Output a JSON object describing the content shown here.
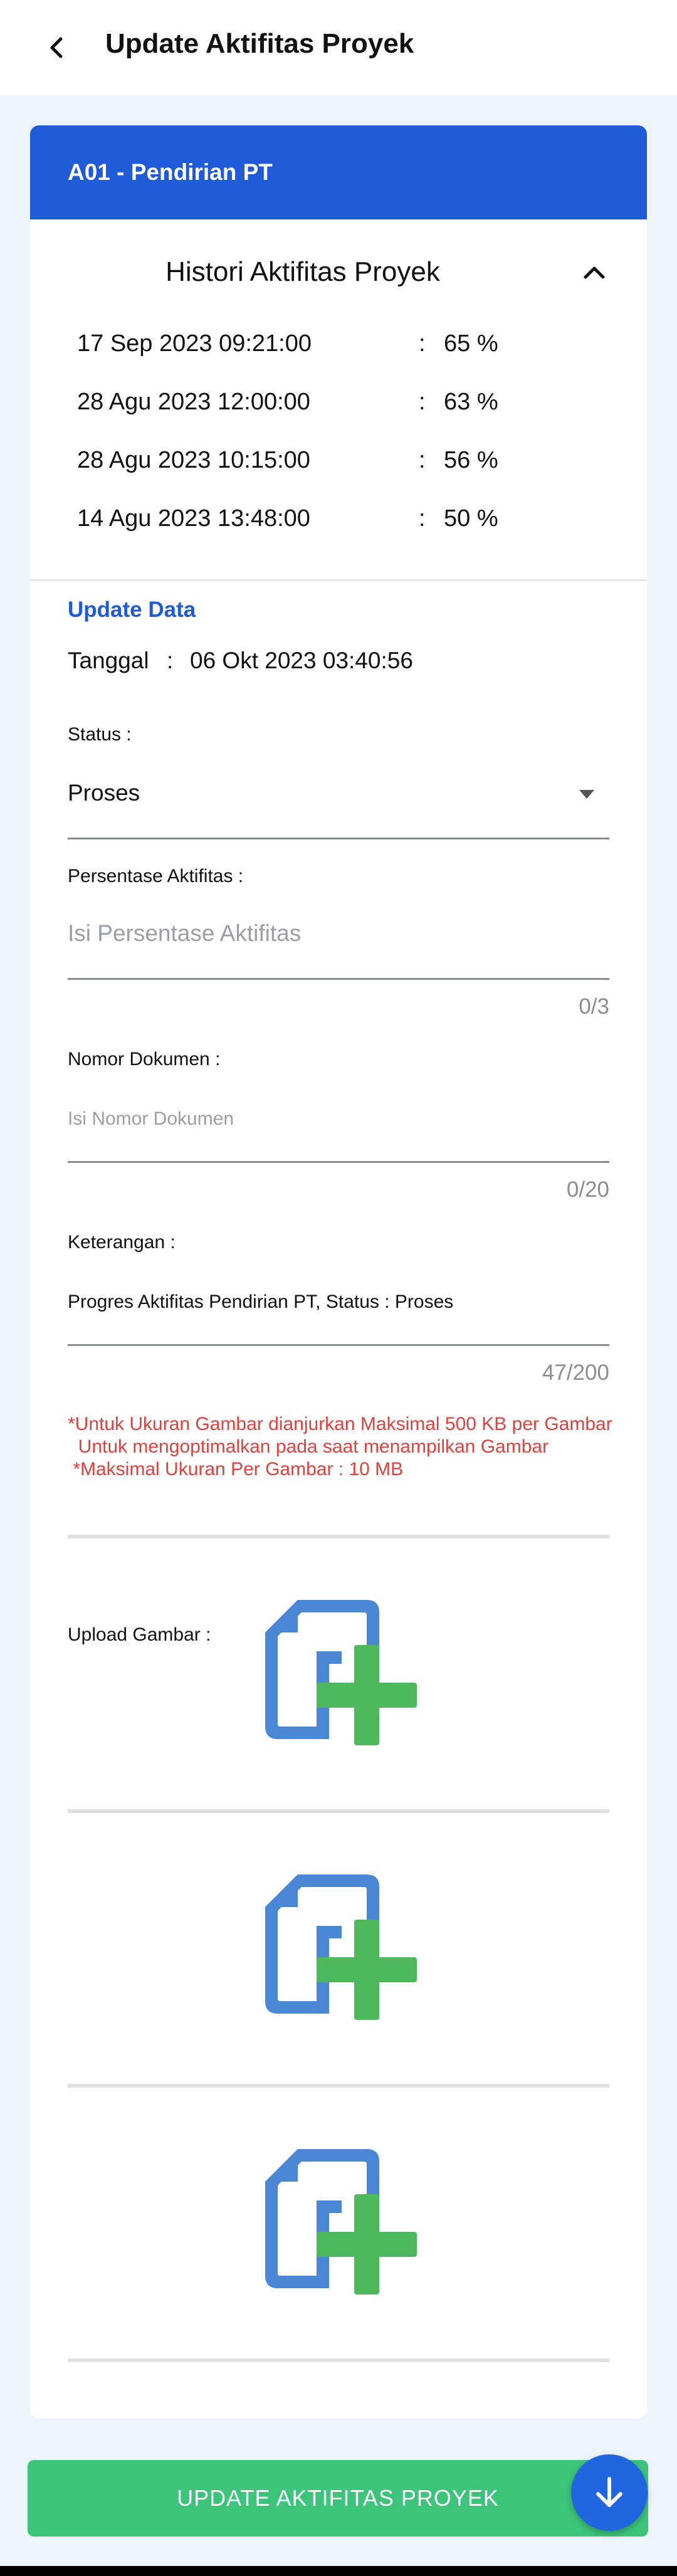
{
  "header": {
    "title": "Update Aktifitas Proyek"
  },
  "card": {
    "title": "A01 - Pendirian PT",
    "history": {
      "title": "Histori Aktifitas Proyek",
      "rows": [
        {
          "date": "17 Sep 2023 09:21:00",
          "sep": ":",
          "percent": "65 %"
        },
        {
          "date": "28 Agu 2023 12:00:00",
          "sep": ":",
          "percent": "63 %"
        },
        {
          "date": "28 Agu 2023 10:15:00",
          "sep": ":",
          "percent": "56 %"
        },
        {
          "date": "14 Agu 2023 13:48:00",
          "sep": ":",
          "percent": "50 %"
        }
      ]
    },
    "update": {
      "section_title": "Update Data",
      "tanggal_label": "Tanggal",
      "tanggal_sep": ":",
      "tanggal_value": "06 Okt 2023 03:40:56",
      "status": {
        "label": "Status :",
        "value": "Proses"
      },
      "persentase": {
        "label": "Persentase Aktifitas :",
        "placeholder": "Isi Persentase Aktifitas",
        "counter": "0/3"
      },
      "nomor": {
        "label": "Nomor Dokumen :",
        "placeholder": "Isi Nomor Dokumen",
        "counter": "0/20"
      },
      "keterangan": {
        "label": "Keterangan :",
        "value": "Progres Aktifitas Pendirian PT, Status : Proses",
        "counter": "47/200"
      },
      "warning": {
        "line1": "*Untuk Ukuran Gambar dianjurkan Maksimal 500 KB per Gambar",
        "line2": "  Untuk mengoptimalkan pada saat menampilkan Gambar",
        "line3": " *Maksimal Ukuran Per Gambar : 10 MB"
      },
      "upload_label": "Upload Gambar :",
      "upload_slots": [
        {
          "icon": "add-file-icon"
        },
        {
          "icon": "add-file-icon"
        },
        {
          "icon": "add-file-icon"
        }
      ]
    }
  },
  "footer": {
    "submit_label": "UPDATE AKTIFITAS PROYEK",
    "fab_icon": "arrow-down-icon"
  },
  "colors": {
    "primary": "#1f5bd8",
    "success": "#3cc47a",
    "warning": "#e0413c",
    "fab": "#1f66e0",
    "icon_blue": "#4a87d4",
    "icon_green": "#4db85c"
  }
}
